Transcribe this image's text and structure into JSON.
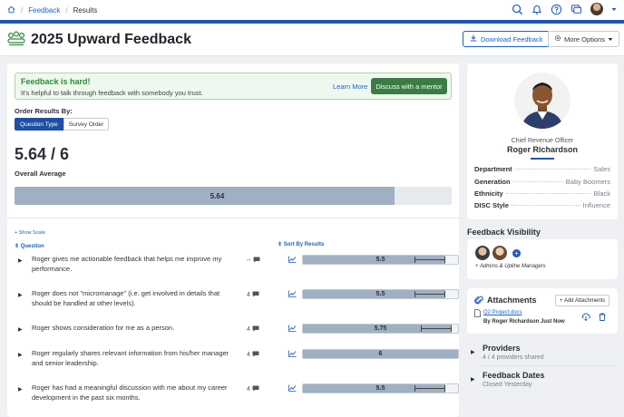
{
  "breadcrumb": {
    "feedback": "Feedback",
    "results": "Results"
  },
  "page": {
    "title": "2025 Upward Feedback"
  },
  "header": {
    "download_label": "Download Feedback",
    "more_options_label": "More Options"
  },
  "banner": {
    "title": "Feedback is hard!",
    "subtitle": "It's helpful to talk through feedback with somebody you trust.",
    "learn_more": "Learn More",
    "mentor_button": "Discuss with a mentor"
  },
  "order": {
    "label": "Order Results By:",
    "options": [
      "Question Type",
      "Survey Order"
    ],
    "selected": "Question Type"
  },
  "summary": {
    "score": "5.64 / 6",
    "label": "Overall Average",
    "value": "5.64",
    "value_num": 5.64,
    "max": 6
  },
  "results": {
    "show_scale": "+ Show Scale",
    "question_header": "Question",
    "sort_header": "Sort By Results",
    "rows": [
      {
        "question": "Roger gives me actionable feedback that helps me improve my performance.",
        "count": "--",
        "value": "5.5"
      },
      {
        "question": "Roger does not \"micromanage\" (i.e. get involved in details that should be handled at other levels).",
        "count": "4",
        "value": "5.5"
      },
      {
        "question": "Roger shows consideration for me as a person.",
        "count": "4",
        "value": "5.75"
      },
      {
        "question": "Roger regularly shares relevant information from his/her manager and senior leadership.",
        "count": "4",
        "value": "6"
      },
      {
        "question": "Roger has had a meaningful discussion with me about my career development in the past six months.",
        "count": "4",
        "value": "5.5"
      }
    ]
  },
  "profile": {
    "role": "Chief Revenue Officer",
    "name": "Roger Richardson",
    "attributes": [
      {
        "key": "Department",
        "value": "Sales"
      },
      {
        "key": "Generation",
        "value": "Baby Boomers"
      },
      {
        "key": "Ethnicity",
        "value": "Black"
      },
      {
        "key": "DISC Style",
        "value": "Influence"
      }
    ]
  },
  "visibility": {
    "title": "Feedback Visibility",
    "note": "+ Admins & Upline Managers"
  },
  "attachments": {
    "title": "Attachments",
    "add_label": "+ Add Attachments",
    "file_name": "Q2 Project.docs",
    "uploaded_by": "By Roger Richardson Just Now"
  },
  "providers": {
    "title": "Providers",
    "subtitle": "4 / 4 providers shared"
  },
  "dates": {
    "title": "Feedback Dates",
    "subtitle": "Closed Yesterday"
  },
  "colors": {
    "primary": "#1f56b8",
    "bar": "#9fb0c3",
    "success": "#3a7d44"
  }
}
